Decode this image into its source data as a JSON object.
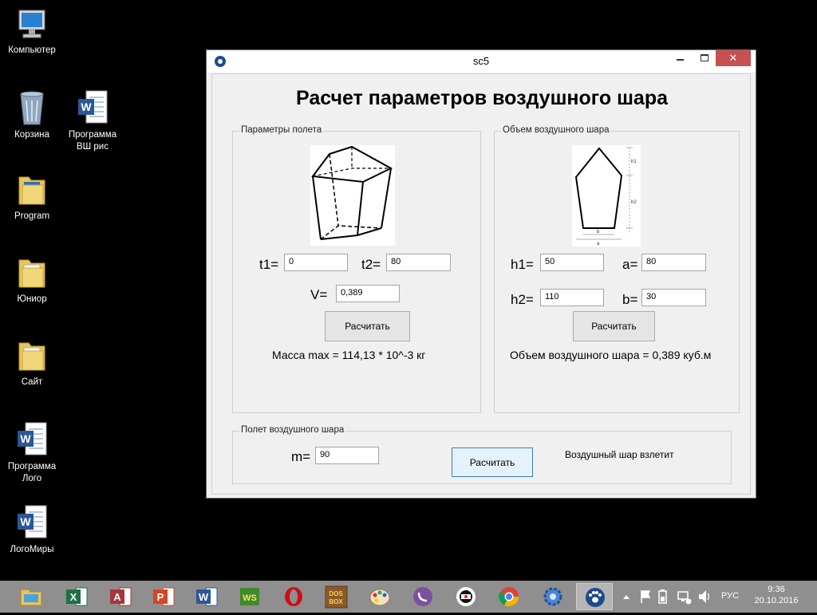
{
  "desktop": {
    "icons": [
      {
        "label": "Компьютер",
        "icon": "computer-icon"
      },
      {
        "label": "Корзина",
        "icon": "recycle-bin-icon"
      },
      {
        "label": "Программа ВШ рис",
        "icon": "word-document-icon"
      },
      {
        "label": "Program",
        "icon": "folder-icon"
      },
      {
        "label": "Юниор",
        "icon": "folder-icon"
      },
      {
        "label": "Сайт",
        "icon": "folder-icon"
      },
      {
        "label": "Программа Лого",
        "icon": "word-document-icon"
      },
      {
        "label": "ЛогоМиры",
        "icon": "word-document-icon"
      }
    ]
  },
  "window": {
    "title": "sc5",
    "close_glyph": "✕",
    "heading": "Расчет параметров воздушного шара",
    "flight": {
      "group_label": "Параметры полета",
      "t1_label": "t1=",
      "t1_value": "0",
      "t2_label": "t2=",
      "t2_value": "80",
      "v_label": "V=",
      "v_value": "0,389",
      "button": "Расчитать",
      "result": "Масса max = 114,13 * 10^-3 кг"
    },
    "volume": {
      "group_label": "Объем воздушного шара",
      "h1_label": "h1=",
      "h1_value": "50",
      "a_label": "a=",
      "a_value": "80",
      "h2_label": "h2=",
      "h2_value": "110",
      "b_label": "b=",
      "b_value": "30",
      "button": "Расчитать",
      "result": "Объем воздушного шара = 0,389 куб.м",
      "diagram_labels": {
        "h1": "h1",
        "h2": "h2",
        "b": "b",
        "a": "a"
      }
    },
    "balloon": {
      "group_label": "Полет воздушного шара",
      "m_label": "m=",
      "m_value": "90",
      "button": "Расчитать",
      "result": "Воздушный шар взлетит"
    }
  },
  "taskbar": {
    "apps": [
      "file-explorer-icon",
      "excel-icon",
      "access-icon",
      "powerpoint-icon",
      "word-icon",
      "ws-icon",
      "opera-icon",
      "dosbox-icon",
      "paint-icon",
      "viber-icon",
      "recorder-icon",
      "chrome-icon",
      "settings-gear-icon",
      "paw-app-icon"
    ],
    "language": "РУС",
    "time": "9:36",
    "date": "20.10.2016"
  }
}
